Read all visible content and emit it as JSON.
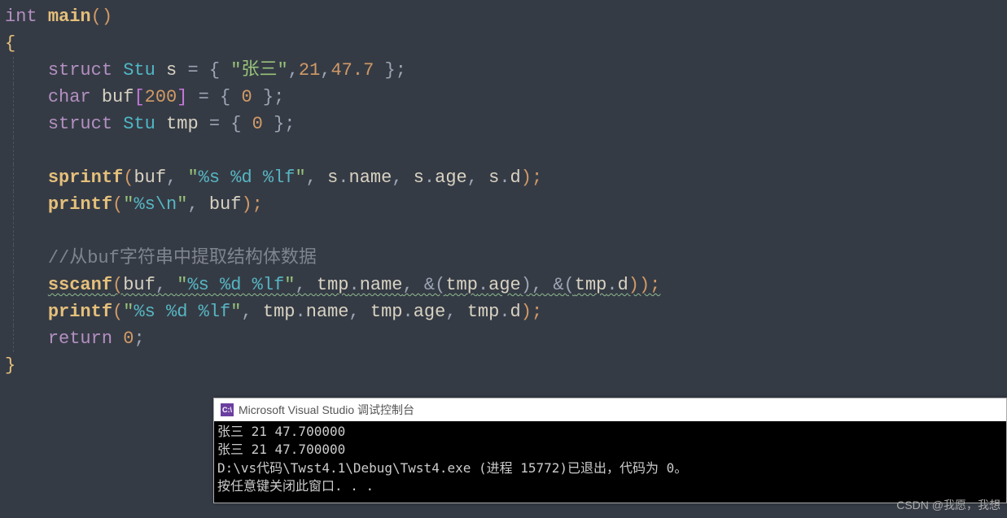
{
  "code": {
    "l1_int": "int",
    "l1_main": "main",
    "l1_paren": "()",
    "l2_brace": "{",
    "l3_struct": "struct",
    "l3_Stu": "Stu",
    "l3_s": "s",
    "l3_eq": " = { ",
    "l3_str": "\"张三\"",
    "l3_comma1": ",",
    "l3_num1": "21",
    "l3_comma2": ",",
    "l3_num2": "47.7",
    "l3_end": " };",
    "l4_char": "char",
    "l4_buf": "buf",
    "l4_br_open": "[",
    "l4_200": "200",
    "l4_br_close": "]",
    "l4_rest": " = { ",
    "l4_zero": "0",
    "l4_end": " };",
    "l5_struct": "struct",
    "l5_Stu": "Stu",
    "l5_tmp": "tmp",
    "l5_rest": " = { ",
    "l5_zero": "0",
    "l5_end": " };",
    "l7_sprintf": "sprintf",
    "l7_p1": "(",
    "l7_buf": "buf",
    "l7_c1": ", ",
    "l7_fmt_q1": "\"",
    "l7_fmt1": "%s %d %lf",
    "l7_fmt_q2": "\"",
    "l7_c2": ", ",
    "l7_s1": "s",
    "l7_dot1": ".",
    "l7_name": "name",
    "l7_c3": ", ",
    "l7_s2": "s",
    "l7_dot2": ".",
    "l7_age": "age",
    "l7_c4": ", ",
    "l7_s3": "s",
    "l7_dot3": ".",
    "l7_d": "d",
    "l7_p2": ");",
    "l8_printf": "printf",
    "l8_p1": "(",
    "l8_fmt_q1": "\"",
    "l8_fmt": "%s",
    "l8_esc": "\\n",
    "l8_fmt_q2": "\"",
    "l8_c1": ", ",
    "l8_buf": "buf",
    "l8_p2": ");",
    "l10_comment": "//从buf字符串中提取结构体数据",
    "l11_sscanf": "sscanf",
    "l11_p1": "(",
    "l11_buf": "buf",
    "l11_c1": ", ",
    "l11_q1": "\"",
    "l11_fmt": "%s %d %lf",
    "l11_q2": "\"",
    "l11_c2": ", ",
    "l11_tmp1": "tmp",
    "l11_d1": ".",
    "l11_name": "name",
    "l11_c3": ", &(",
    "l11_tmp2": "tmp",
    "l11_d2": ".",
    "l11_age": "age",
    "l11_c4": "), &(",
    "l11_tmp3": "tmp",
    "l11_d3": ".",
    "l11_dd": "d",
    "l11_c5": "));",
    "l12_printf": "printf",
    "l12_p1": "(",
    "l12_q1": "\"",
    "l12_fmt": "%s %d %lf",
    "l12_q2": "\"",
    "l12_c1": ", ",
    "l12_tmp1": "tmp",
    "l12_d1": ".",
    "l12_name": "name",
    "l12_c2": ", ",
    "l12_tmp2": "tmp",
    "l12_d2": ".",
    "l12_age": "age",
    "l12_c3": ", ",
    "l12_tmp3": "tmp",
    "l12_d3": ".",
    "l12_dd": "d",
    "l12_p2": ");",
    "l13_return": "return",
    "l13_zero": "0",
    "l13_semi": ";",
    "l14_brace": "}"
  },
  "console": {
    "icon_text": "C:\\",
    "title": "Microsoft Visual Studio 调试控制台",
    "line1": "张三 21 47.700000",
    "line2": "张三 21 47.700000",
    "line3": "D:\\vs代码\\Twst4.1\\Debug\\Twst4.exe (进程 15772)已退出，代码为 0。",
    "line4": "按任意键关闭此窗口. . ."
  },
  "watermark": "CSDN @我愿，我想"
}
